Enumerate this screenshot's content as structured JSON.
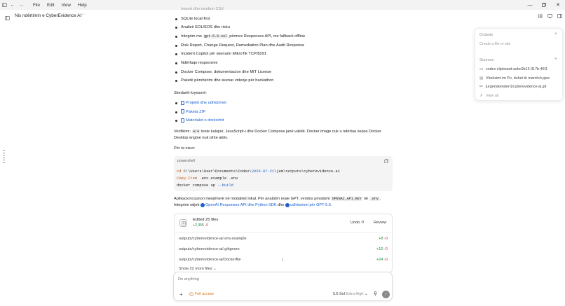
{
  "menubar": {
    "items": [
      "File",
      "Edit",
      "View",
      "Help"
    ]
  },
  "thread": {
    "title": "Nis ndërtimin e CyberEvidence AI",
    "more": "···"
  },
  "features": {
    "partial_top": "Import dhe random CSV",
    "items": [
      {
        "text": "SQLite local-first"
      },
      {
        "text": "Analizë EOL/EOS dhe risku"
      },
      {
        "pre": "Integrim me ",
        "code": "gpt-5.6-sol",
        "post": " përmes Responses API, me fallback offline"
      },
      {
        "text": "Risk Report, Change Request, Remediation Plan dhe Audit Response"
      },
      {
        "text": "Incident Copilot për skenarin MikroTik TCP/8291"
      },
      {
        "text": "Ndërfaqe responsive"
      },
      {
        "text": "Docker Compose, dokumentacion dhe MIT License"
      },
      {
        "text": "Paketë përshkrimi dhe skenar videoje për hackathon"
      }
    ]
  },
  "key_files": {
    "heading": "Skedarët kryesorë:",
    "links": [
      "Projekti dhe udhëzimet",
      "Paketa ZIP",
      "Materialet e dorëzimit"
    ]
  },
  "verification": {
    "label": "Verifikimi:",
    "code": "4/4",
    "text1": " teste kalojnë, JavaScript-i dhe Docker Compose janë validë. Docker image nuk u ndërtua sepse Docker",
    "text2": "Desktop engine nuk ishte aktiv."
  },
  "start_label": "Për ta nisur:",
  "codeblock": {
    "lang": "powershell",
    "line1_cmd": "cd ",
    "line1_path_a": "C:\\Users\\User\\Documents\\Codex\\",
    "line1_date": "2026-07-21",
    "line1_path_b": "\\jem\\outputs\\cyberevidence-ai",
    "line2_cmd": "Copy-Item",
    "line2_args": " .env.example .env",
    "line3_cmd": "docker compose up ",
    "line3_flag": "--build"
  },
  "note": {
    "text1": "Aplikacioni punon menjëherë në modalitet lokal. Për analizën reale GPT, vendos privatisht ",
    "code1": "OPENAI_API_KEY",
    "mid1": " në ",
    "code2": ".env",
    "end1": ".",
    "pre2": "Integrimi ndjek ",
    "link1": "OpenAI Responses API dhe Python SDK",
    "mid2": " dhe ",
    "link2": "udhëzimet për GPT-5.6",
    "end2": "."
  },
  "edits": {
    "title": "Edited 25 files",
    "add_total": "+2,355",
    "del_total": "-0",
    "undo_label": "Undo",
    "review_label": "Review",
    "files": [
      {
        "path": "outputs/cyberevidence-ai/.env.example",
        "add": "+8",
        "del": "-0"
      },
      {
        "path": "outputs/cyberevidence-ai/.gitignore",
        "add": "+10",
        "del": "-0"
      },
      {
        "path": "outputs/cyberevidence-ai/Dockerfile",
        "add": "+24",
        "del": "-0"
      }
    ],
    "show_more": "Show 22 more files"
  },
  "composer": {
    "placeholder": "Do anything",
    "access_label": "Full access",
    "model": "5.6 Sol",
    "effort": "Extra High"
  },
  "side_panel": {
    "outputs_label": "Outputs",
    "outputs_empty": "Create a file or site",
    "sources_label": "Sources",
    "sources": [
      {
        "icon": "image-icon",
        "text": "codex-clipboard-aebc9b13-317b-46f1"
      },
      {
        "icon": "chat-icon",
        "text": "Vlerësimi im Po, duhet të marrësh pjes"
      },
      {
        "icon": "link-icon",
        "text": "jurgenskenderi1/cyberevidence-ai.git"
      }
    ],
    "view_all": "View all"
  },
  "colors": {
    "link": "#1a5fd0",
    "add": "#1a8a3e",
    "delete": "#c7332c",
    "accent_orange": "#d9731a"
  }
}
